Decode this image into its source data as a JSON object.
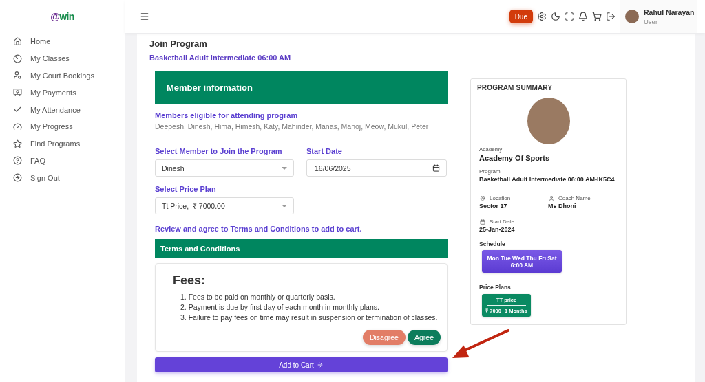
{
  "sidebar": {
    "logo": {
      "prefix": "@",
      "name": "win"
    },
    "items": [
      {
        "label": "Home",
        "selected": false
      },
      {
        "label": "My Classes",
        "selected": false
      },
      {
        "label": "My Court Bookings",
        "selected": false
      },
      {
        "label": "My Payments",
        "selected": false
      },
      {
        "label": "My Attendance",
        "selected": false
      },
      {
        "label": "My Progress",
        "selected": false
      },
      {
        "label": "Find Programs",
        "selected": false
      },
      {
        "label": "FAQ",
        "selected": false
      },
      {
        "label": "Sign Out",
        "selected": false
      }
    ]
  },
  "topbar": {
    "due_button": "Due",
    "user": {
      "name": "Rahul Narayan",
      "role": "User"
    }
  },
  "page": {
    "title": "Join Program",
    "program": "Basketball Adult Intermediate 06:00 AM"
  },
  "member_info": {
    "header": "Member information",
    "eligible_label": "Members eligible for attending program",
    "eligible_members": "Deepesh, Dinesh, Hima, Himesh, Katy, Mahinder, Manas, Manoj, Meow, Mukul, Peter"
  },
  "form": {
    "member": {
      "label": "Select Member to Join the Program",
      "value": "Dinesh"
    },
    "start_date": {
      "label": "Start Date",
      "value": "16/06/2025"
    },
    "price_plan": {
      "label": "Select Price Plan",
      "value": "Tt Price,  ₹ 7000.00"
    }
  },
  "terms": {
    "notice": "Review and agree to Terms and Conditions to add to cart.",
    "header": "Terms and Conditions",
    "heading": "Fees:",
    "items": [
      "1. Fees to be paid on monthly or quarterly basis.",
      "2. Payment is due by first day of each month in monthly plans.",
      "3. Failure to pay fees on time may result in suspension or termination of classes."
    ],
    "buttons": [
      {
        "label": "Disagree",
        "kind": "disagree"
      },
      {
        "label": "Agree",
        "kind": "agree"
      }
    ]
  },
  "add_to_cart": {
    "label": "Add to Cart"
  },
  "summary": {
    "title": "PROGRAM SUMMARY",
    "academy_label": "Academy",
    "academy": "Academy Of Sports",
    "program_label": "Program",
    "program": "Basketball Adult Intermediate 06:00 AM-IK5C4",
    "details": [
      {
        "label": "Location",
        "value": "Sector 17"
      },
      {
        "label": "Coach Name",
        "value": "Ms Dhoni"
      },
      {
        "label": "Start Date",
        "value": "25-Jan-2024"
      }
    ],
    "schedule_label": "Schedule",
    "schedule": {
      "days": "Mon Tue Wed Thu Fri Sat",
      "time": "6:00 AM"
    },
    "price_plans_label": "Price Plans",
    "price_plans": [
      {
        "name": "TT price",
        "price": "₹ 7000",
        "duration": "1 Months"
      }
    ]
  }
}
